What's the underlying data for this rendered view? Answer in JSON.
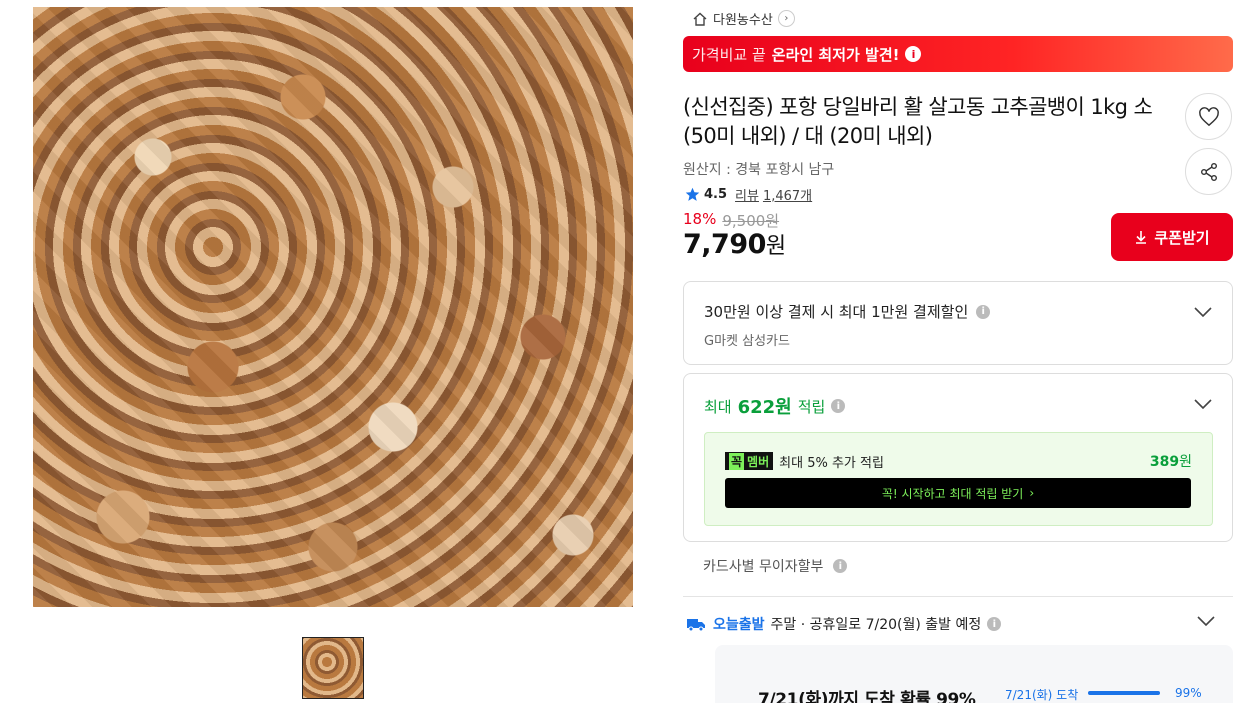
{
  "store": {
    "name": "다원농수산",
    "home_icon": "home-icon",
    "chevron_icon": "chevron-right-icon"
  },
  "promo": {
    "prefix": "가격비교 끝",
    "highlight": "온라인 최저가 발견!",
    "info_icon": "info-icon"
  },
  "product": {
    "title": "(신선집중) 포항 당일바리 활 살고동 고추골뱅이 1kg 소 (50미 내외) / 대 (20미 내외)",
    "origin": "원산지 : 경북 포항시 남구",
    "rating": "4.5",
    "review_label": "리뷰",
    "review_count": "1,467개",
    "discount_pct": "18%",
    "original_price": "9,500원",
    "price": "7,790",
    "price_unit": "원"
  },
  "coupon_button": {
    "label": "쿠폰받기",
    "icon": "download-icon"
  },
  "payment_discount": {
    "title": "30만원 이상 결제 시 최대 1만원 결제할인",
    "subtitle": "G마켓 삼성카드"
  },
  "points": {
    "prefix": "최대",
    "amount": "622원",
    "suffix": "적립",
    "member_badge_a": "꼭",
    "member_badge_b": "멤버",
    "member_text": "최대 5% 추가 적립",
    "member_amount": "389",
    "member_amount_unit": "원",
    "cta": "꼭! 시작하고 최대 적립 받기",
    "cta_arrow": "›"
  },
  "installments": {
    "label": "카드사별 무이자할부"
  },
  "delivery": {
    "badge": "오늘출발",
    "text": "주말 · 공휴일로 7/20(월) 출발 예정",
    "arrival": "7/21(화)까지 도착 확률 99%",
    "arrival_small": "7/21(화) 도착",
    "arrival_pct": "99%",
    "arrival_fraction": 0.99
  },
  "colors": {
    "accent_red": "#e8001c",
    "points_green": "#0a9f3b",
    "delivery_blue": "#1a73e8"
  }
}
